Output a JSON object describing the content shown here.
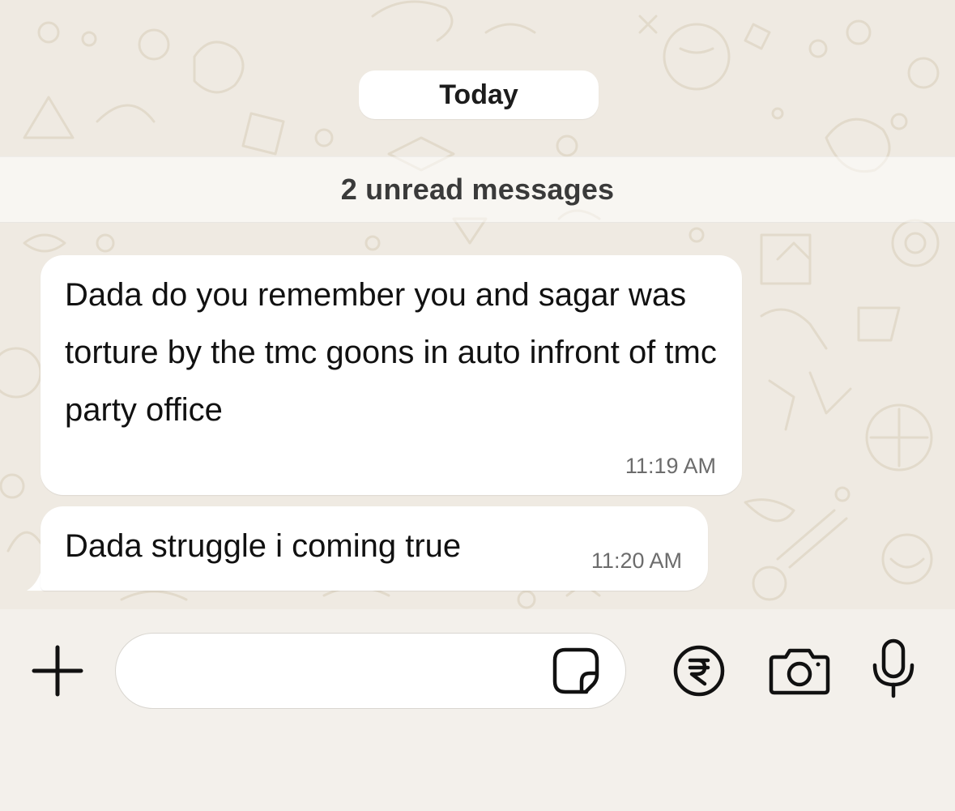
{
  "date_separator": {
    "label": "Today"
  },
  "unread_banner": {
    "label": "2 unread messages"
  },
  "messages": [
    {
      "text": "Dada do you remember you and sagar was torture by the tmc goons in auto infront of tmc party office",
      "time": "11:19 AM"
    },
    {
      "text": "Dada struggle i coming true",
      "time": "11:20 AM"
    }
  ],
  "composer": {
    "placeholder": "",
    "icons": [
      "plus-icon",
      "sticker-icon",
      "rupee-icon",
      "camera-icon",
      "microphone-icon"
    ]
  },
  "colors": {
    "chat_background": "#efeae2",
    "bubble": "#ffffff",
    "timestamp": "#6c6c6c",
    "icon": "#111111"
  }
}
